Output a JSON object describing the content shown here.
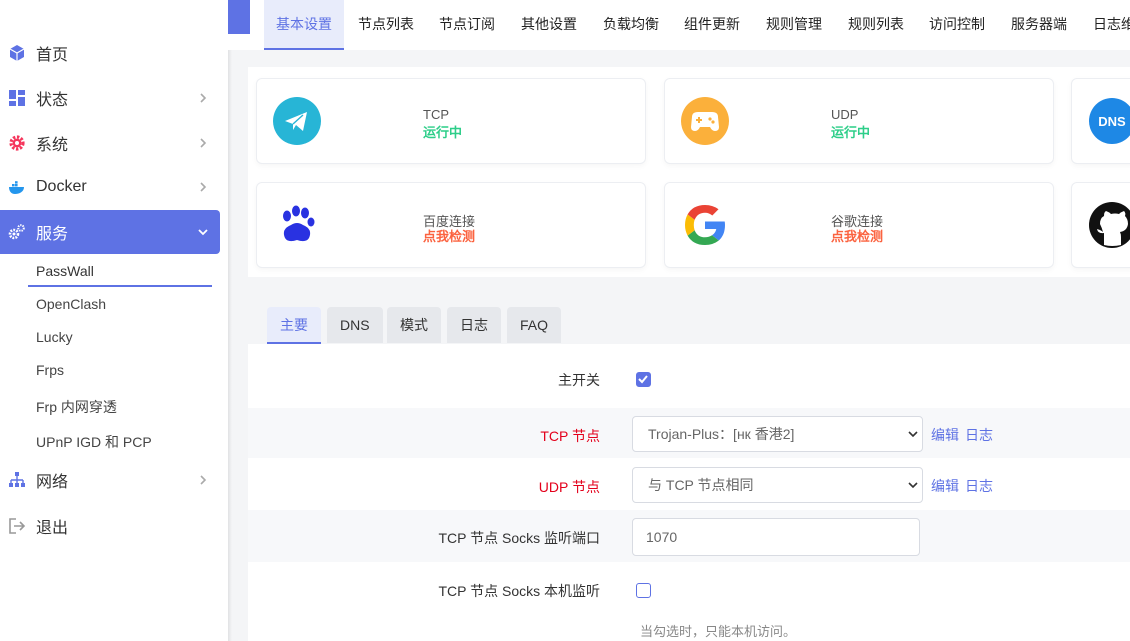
{
  "sidebar": {
    "items": [
      {
        "label": "首页",
        "icon": "cube-icon"
      },
      {
        "label": "状态",
        "icon": "dashboard-icon"
      },
      {
        "label": "系统",
        "icon": "gear-icon"
      },
      {
        "label": "Docker",
        "icon": "docker-icon"
      },
      {
        "label": "服务",
        "icon": "cogs-icon"
      },
      {
        "label": "网络",
        "icon": "network-icon"
      },
      {
        "label": "退出",
        "icon": "logout-icon"
      }
    ],
    "service_subitems": [
      "PassWall",
      "OpenClash",
      "Lucky",
      "Frps",
      "Frp 内网穿透",
      "UPnP IGD 和 PCP"
    ]
  },
  "top_tabs": [
    "基本设置",
    "节点列表",
    "节点订阅",
    "其他设置",
    "负载均衡",
    "组件更新",
    "规则管理",
    "规则列表",
    "访问控制",
    "服务器端",
    "日志维"
  ],
  "status_cards": [
    {
      "title": "TCP",
      "status": "运行中"
    },
    {
      "title": "UDP",
      "status": "运行中"
    },
    {
      "title": "百度连接",
      "status": "点我检测"
    },
    {
      "title": "谷歌连接",
      "status": "点我检测"
    }
  ],
  "dns_label": "DNS",
  "form": {
    "sub_tabs": [
      "主要",
      "DNS",
      "模式",
      "日志",
      "FAQ"
    ],
    "main_switch_label": "主开关",
    "tcp_node_label": "TCP 节点",
    "tcp_node_value": "Trojan-Plus：[нк 香港2]",
    "udp_node_label": "UDP 节点",
    "udp_node_value": "与 TCP 节点相同",
    "edit_link": "编辑",
    "log_link": "日志",
    "socks_port_label": "TCP 节点 Socks 监听端口",
    "socks_port_value": "1070",
    "socks_local_label": "TCP 节点 Socks 本机监听",
    "socks_local_hint": "当勾选时，只能本机访问。"
  },
  "colors": {
    "accent": "#5e72e4",
    "running": "#2dce89",
    "check": "#fb6340",
    "required": "#e3001b"
  }
}
